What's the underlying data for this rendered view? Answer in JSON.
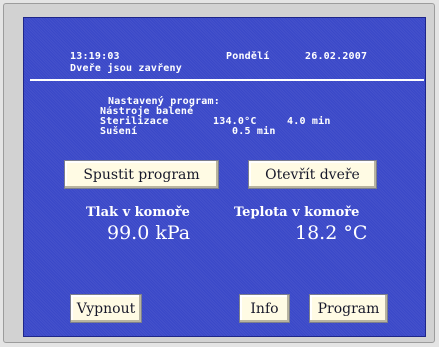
{
  "header": {
    "time": "13:19:03",
    "day": "Pondělí",
    "date": "26.02.2007",
    "door_status": "Dveře jsou zavřeny"
  },
  "program": {
    "heading": "Nastavený program:",
    "name": "Nástroje balené",
    "sterilization_label": "Sterilizace",
    "sterilization_temp": "134.0°C",
    "sterilization_time": "4.0  min",
    "drying_label": "Sušení",
    "drying_time": "0.5 min"
  },
  "buttons": {
    "start_program": "Spustit program",
    "open_door": "Otevřít dveře",
    "power_off": "Vypnout",
    "info": "Info",
    "program": "Program"
  },
  "readings": {
    "pressure_label": "Tlak v komoře",
    "pressure_value": "99.0 kPa",
    "temperature_label": "Teplota v komoře",
    "temperature_value": "18.2 °C"
  },
  "colors": {
    "screen_background": "#3a48c8",
    "button_background": "#fffbe4",
    "text": "#ffffff"
  }
}
